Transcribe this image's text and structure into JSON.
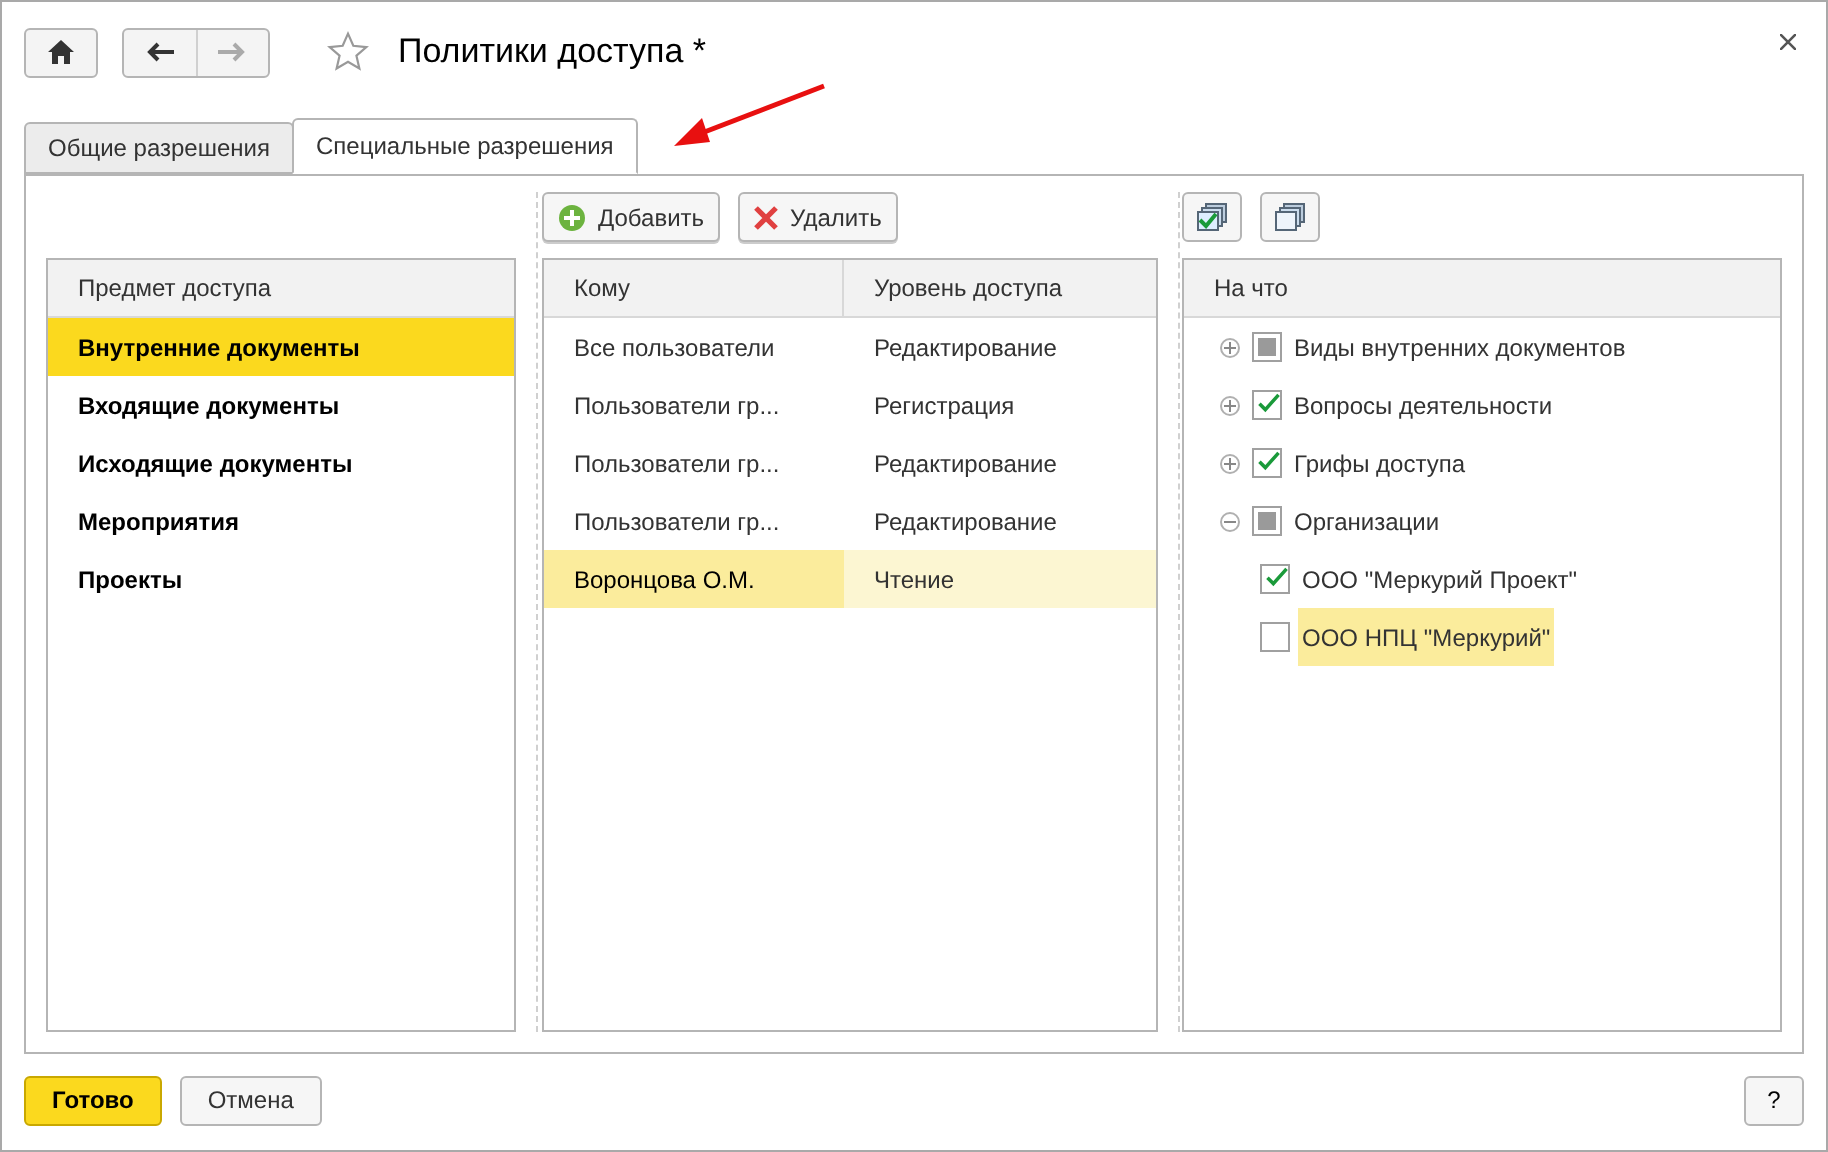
{
  "window": {
    "title": "Политики доступа *"
  },
  "tabs": [
    {
      "label": "Общие разрешения",
      "selected": false
    },
    {
      "label": "Специальные разрешения",
      "selected": true
    }
  ],
  "subjects": {
    "heading": "Предмет доступа",
    "items": [
      {
        "label": "Внутренние документы",
        "selected": true
      },
      {
        "label": "Входящие документы",
        "selected": false
      },
      {
        "label": "Исходящие документы",
        "selected": false
      },
      {
        "label": "Мероприятия",
        "selected": false
      },
      {
        "label": "Проекты",
        "selected": false
      }
    ]
  },
  "recipients": {
    "toolbar": [
      {
        "label": "Добавить",
        "kind": "add"
      },
      {
        "label": "Удалить",
        "kind": "delete"
      }
    ],
    "columns": [
      "Кому",
      "Уровень доступа"
    ],
    "rows": [
      {
        "cells": [
          "Все пользователи",
          "Редактирование"
        ],
        "selected": false
      },
      {
        "cells": [
          "Пользователи гр...",
          "Регистрация"
        ],
        "selected": false
      },
      {
        "cells": [
          "Пользователи гр...",
          "Редактирование"
        ],
        "selected": false
      },
      {
        "cells": [
          "Пользователи гр...",
          "Редактирование"
        ],
        "selected": false
      },
      {
        "cells": [
          "Воронцова О.М.",
          "Чтение"
        ],
        "selected": true
      }
    ]
  },
  "objects": {
    "heading": "На что",
    "tree": [
      {
        "label": "Виды внутренних документов",
        "checked": false,
        "partial": true,
        "expanded": false,
        "selected": false
      },
      {
        "label": "Вопросы деятельности",
        "checked": true,
        "partial": false,
        "expanded": false,
        "selected": false
      },
      {
        "label": "Грифы доступа",
        "checked": true,
        "partial": false,
        "expanded": false,
        "selected": false
      },
      {
        "label": "Организации",
        "checked": false,
        "partial": true,
        "expanded": true,
        "selected": false,
        "children": [
          {
            "label": "ООО \"Меркурий Проект\"",
            "checked": true,
            "partial": false,
            "selected": false
          },
          {
            "label": "ООО НПЦ \"Меркурий\"",
            "checked": false,
            "partial": false,
            "selected": true
          }
        ]
      }
    ]
  },
  "footer": {
    "buttons": [
      {
        "label": "Готово",
        "kind": "primary"
      },
      {
        "label": "Отмена",
        "kind": "normal"
      }
    ],
    "help": "?"
  }
}
